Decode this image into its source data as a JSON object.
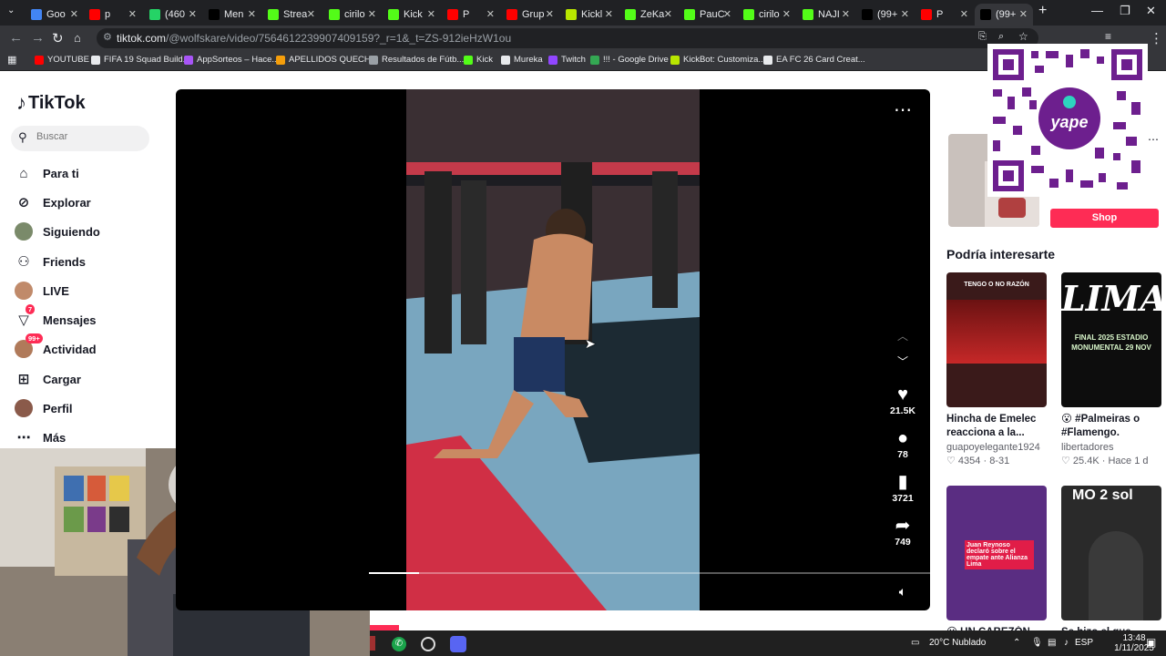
{
  "browser": {
    "tabs": [
      {
        "label": "Goo",
        "color": "#4285f4"
      },
      {
        "label": "p",
        "color": "#ff0000"
      },
      {
        "label": "(460",
        "color": "#25d366"
      },
      {
        "label": "Men",
        "color": "#000000"
      },
      {
        "label": "Strea",
        "color": "#53fc18"
      },
      {
        "label": "cirilo",
        "color": "#53fc18"
      },
      {
        "label": "Kick",
        "color": "#53fc18"
      },
      {
        "label": "P",
        "color": "#ff0000"
      },
      {
        "label": "Grup",
        "color": "#ff0000"
      },
      {
        "label": "Kickl",
        "color": "#b8e600"
      },
      {
        "label": "ZeKa",
        "color": "#53fc18"
      },
      {
        "label": "PauC",
        "color": "#53fc18"
      },
      {
        "label": "cirilo",
        "color": "#53fc18"
      },
      {
        "label": "NAJI",
        "color": "#53fc18"
      },
      {
        "label": "(99+",
        "color": "#000000"
      },
      {
        "label": "P",
        "color": "#ff0000"
      },
      {
        "label": "(99+",
        "color": "#000000"
      }
    ],
    "url_host": "tiktok.com",
    "url_path": "/@wolfskare/video/7564612239907409159?_r=1&_t=ZS-912ieHzW1ou",
    "bookmarks": [
      {
        "label": "YOUTUBE",
        "color": "#ff0000"
      },
      {
        "label": "FIFA 19 Squad Build...",
        "color": "#e8eaed"
      },
      {
        "label": "AppSorteos – Hace...",
        "color": "#a855f7"
      },
      {
        "label": "APELLIDOS QUECH...",
        "color": "#f59e0b"
      },
      {
        "label": "Resultados de Fútb...",
        "color": "#9aa0a6"
      },
      {
        "label": "Kick",
        "color": "#53fc18"
      },
      {
        "label": "Mureka",
        "color": "#e8eaed"
      },
      {
        "label": "Twitch",
        "color": "#9146ff"
      },
      {
        "label": "!!! - Google Drive",
        "color": "#34a853"
      },
      {
        "label": "KickBot: Customiza...",
        "color": "#b8e600"
      },
      {
        "label": "EA FC 26 Card Creat...",
        "color": "#e8eaed"
      }
    ]
  },
  "sidebar": {
    "logo": "TikTok",
    "search_placeholder": "Buscar",
    "items": [
      {
        "label": "Para ti",
        "icon": "home-icon"
      },
      {
        "label": "Explorar",
        "icon": "compass-icon"
      },
      {
        "label": "Siguiendo",
        "icon": "avatar"
      },
      {
        "label": "Friends",
        "icon": "friends-icon"
      },
      {
        "label": "LIVE",
        "icon": "avatar"
      },
      {
        "label": "Mensajes",
        "icon": "inbox-icon",
        "badge": "7"
      },
      {
        "label": "Actividad",
        "icon": "avatar",
        "badge": "99+"
      },
      {
        "label": "Cargar",
        "icon": "upload-icon"
      },
      {
        "label": "Perfil",
        "icon": "avatar"
      },
      {
        "label": "Más",
        "icon": "more-icon"
      }
    ]
  },
  "video": {
    "likes": "21.5K",
    "comments": "78",
    "saves": "3721",
    "shares": "749",
    "progress": 0.09
  },
  "right": {
    "shop_label": "Shop",
    "recs_title": "Podría interesarte",
    "cards": [
      {
        "title": "Hincha de Emelec reacciona a la...",
        "author": "guapoyelegante1924",
        "likes": "4354",
        "date": "8-31",
        "thumb_text": "TENGO O NO RAZÓN",
        "bg": "#3a1a1a"
      },
      {
        "title": "😮 #Palmeiras o #Flamengo. ¿Quién...",
        "author": "libertadores",
        "likes": "25.4K",
        "date": "Hace 1 d",
        "thumb_text": "LIMA",
        "thumb_sub": "FINAL 2025 ESTADIO MONUMENTAL 29 NOV",
        "bg": "#0d0d0d"
      },
      {
        "title": "😮 UN CABEZÓN...",
        "author": "",
        "likes": "",
        "date": "",
        "thumb_text": "Juan Reynoso declaró sobre el empate ante Alianza Lima",
        "bg": "#5a2d82"
      },
      {
        "title": "Se hizo el que...",
        "author": "",
        "likes": "",
        "date": "",
        "thumb_text": "MO 2 sol",
        "bg": "#2a2a2a"
      }
    ]
  },
  "taskbar": {
    "weather": "20°C Nublado",
    "lang": "ESP",
    "time": "13:48",
    "date": "1/11/2025"
  }
}
